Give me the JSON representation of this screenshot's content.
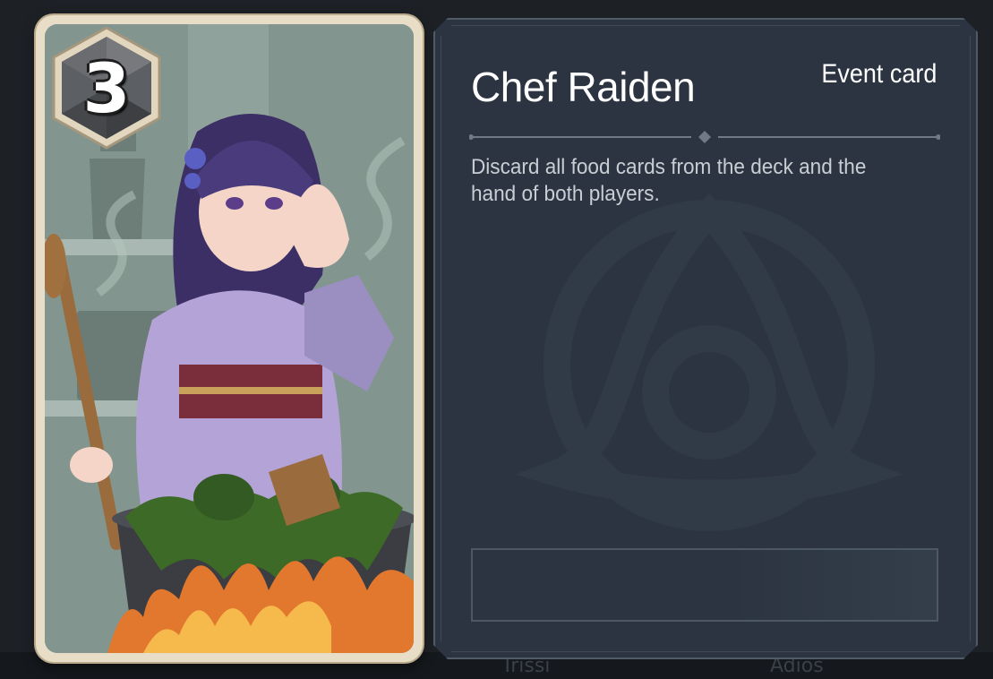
{
  "card": {
    "cost": "3",
    "title": "Chef Raiden",
    "type_label": "Event card",
    "description": "Discard all food cards from the deck and the hand of both players.",
    "illustration_subject": "Character stirring a bubbling cauldron over a fire",
    "cost_icon": "hexagon-die-icon",
    "accent_colors": {
      "frame": "#e8ddc6",
      "panel": "#2b3440",
      "title_text": "#ffffff",
      "description_text": "#c9ced4"
    }
  },
  "background": {
    "partial_labels": [
      "Trissi",
      "Adios"
    ]
  }
}
